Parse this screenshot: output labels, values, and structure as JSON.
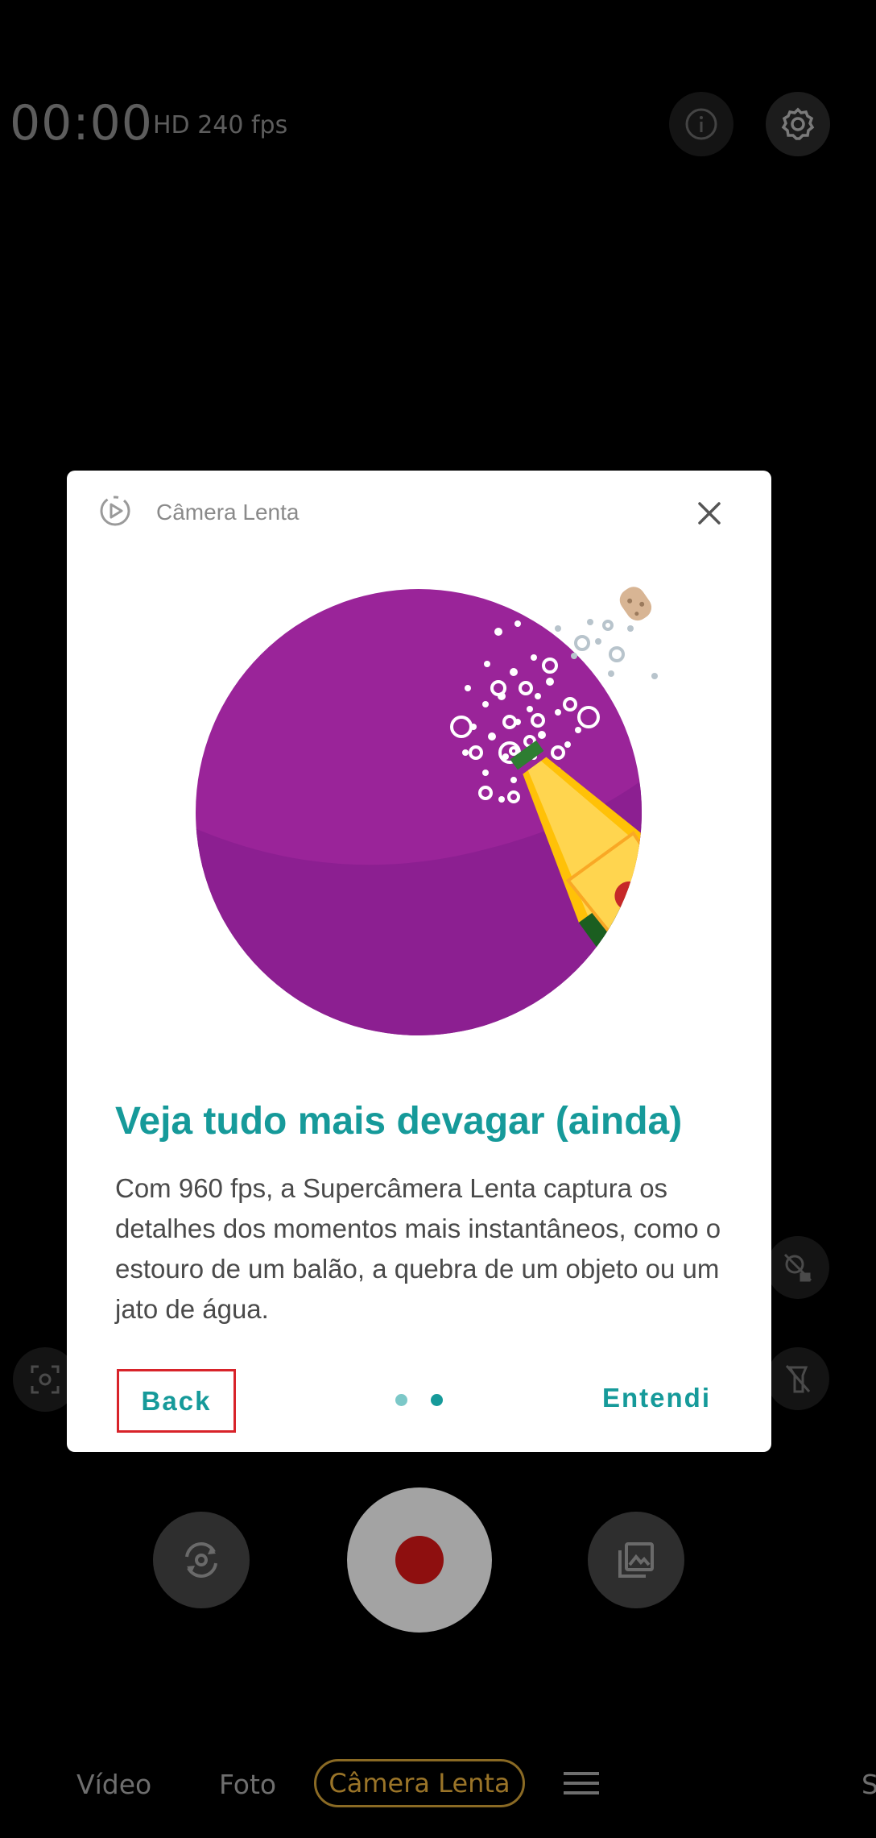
{
  "status": {
    "timer": "00:00",
    "quality": "HD 240 fps"
  },
  "icons": {
    "info": "info-icon",
    "settings": "gear-icon",
    "motion": "motion-icon",
    "focus": "focus-icon",
    "flash": "flash-off-icon",
    "flip": "flip-camera-icon",
    "gallery": "gallery-icon",
    "menu": "menu-icon"
  },
  "modes": {
    "video": "Vídeo",
    "photo": "Foto",
    "slowmo": "Câmera Lenta",
    "more": "Su"
  },
  "dialog": {
    "title": "Câmera Lenta",
    "headline": "Veja tudo mais devagar (ainda)",
    "body": "Com 960 fps, a Supercâmera Lenta captura os detalhes dos momentos mais instantâneos, como o estouro de um balão, a quebra de um objeto ou um jato de água.",
    "back_label": "Back",
    "ok_label": "Entendi",
    "page_indicator": {
      "pages": 2,
      "current": 2
    }
  },
  "colors": {
    "accent": "#169a9a",
    "highlight": "#d8232a",
    "illustration_bg": "#9a2499",
    "slowmo_mode": "#9a7428"
  }
}
